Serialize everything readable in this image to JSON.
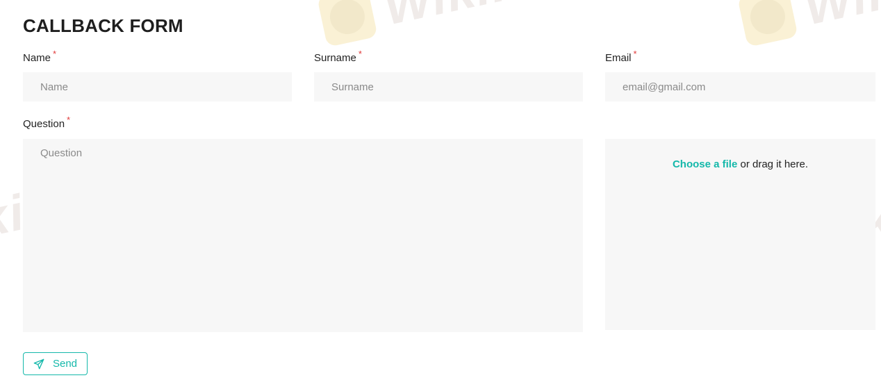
{
  "form": {
    "title": "CALLBACK FORM",
    "required_mark": "*",
    "name": {
      "label": "Name",
      "placeholder": "Name",
      "value": ""
    },
    "surname": {
      "label": "Surname",
      "placeholder": "Surname",
      "value": ""
    },
    "email": {
      "label": "Email",
      "placeholder": "email@gmail.com",
      "value": ""
    },
    "question": {
      "label": "Question",
      "placeholder": "Question",
      "value": ""
    },
    "upload": {
      "link_text": "Choose a file",
      "rest_text": " or drag it here."
    },
    "send_label": "Send"
  },
  "watermark": {
    "text": "WikiFX"
  },
  "colors": {
    "accent": "#14b8aa",
    "required": "#e03a3a",
    "field_bg": "#f7f7f7",
    "text": "#222222"
  },
  "icons": {
    "send": "paper-plane-icon",
    "watermark_logo": "wikifx-logo-icon"
  }
}
